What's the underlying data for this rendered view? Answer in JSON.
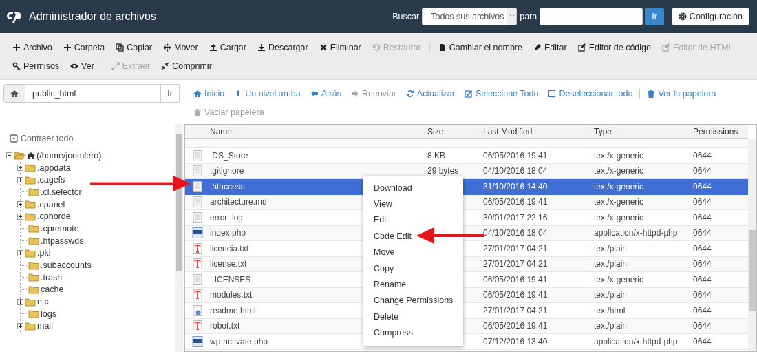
{
  "header": {
    "title": "Administrador de archivos",
    "search_label": "Buscar",
    "search_scope": "Todos sus archivos",
    "for_label": "para",
    "go_button": "Ir",
    "settings_button": "Configuración"
  },
  "toolbar": {
    "rows": [
      {
        "groups": [
          {
            "items": [
              {
                "label": "Archivo",
                "disabled": false
              },
              {
                "label": "Carpeta",
                "disabled": false
              },
              {
                "label": "Copiar",
                "disabled": false
              },
              {
                "label": "Mover",
                "disabled": false
              },
              {
                "label": "Cargar",
                "disabled": false
              },
              {
                "label": "Descargar",
                "disabled": false
              },
              {
                "label": "Eliminar",
                "disabled": false
              },
              {
                "label": "Restaurar",
                "disabled": true
              }
            ]
          },
          {
            "items": [
              {
                "label": "Cambiar el nombre",
                "disabled": false
              },
              {
                "label": "Editar",
                "disabled": false
              },
              {
                "label": "Editor de código",
                "disabled": false
              },
              {
                "label": "Editor de HTML",
                "disabled": true
              }
            ]
          }
        ]
      },
      {
        "groups": [
          {
            "items": [
              {
                "label": "Permisos",
                "disabled": false
              },
              {
                "label": "Ver",
                "disabled": false
              }
            ]
          },
          {
            "items": [
              {
                "label": "Extraer",
                "disabled": true
              },
              {
                "label": "Comprimir",
                "disabled": false
              }
            ]
          }
        ]
      }
    ]
  },
  "path_bar": {
    "value": "public_html",
    "go_button": "Ir"
  },
  "nav": {
    "rows": [
      {
        "groups": [
          {
            "items": [
              {
                "label": "Inicio",
                "disabled": false
              },
              {
                "label": "Un nivel arriba",
                "disabled": false
              },
              {
                "label": "Atrás",
                "disabled": false
              },
              {
                "label": "Reenviar",
                "disabled": true
              },
              {
                "label": "Actualizar",
                "disabled": false
              },
              {
                "label": "Seleccione Todo",
                "disabled": false
              },
              {
                "label": "Deseleccionar todo",
                "disabled": false
              }
            ]
          },
          {
            "items": [
              {
                "label": "Ver la papelera",
                "disabled": false
              }
            ]
          }
        ]
      },
      {
        "groups": [
          {
            "items": [
              {
                "label": "Vaciar papelera",
                "disabled": true
              }
            ]
          }
        ]
      }
    ]
  },
  "tree": {
    "collapse_all": "Contraer todo",
    "root": {
      "label": "(/home/joomlero)",
      "expanded": true,
      "children": [
        {
          "label": ".appdata",
          "expandable": true
        },
        {
          "label": ".cagefs",
          "expandable": true
        },
        {
          "label": ".cl.selector",
          "expandable": false
        },
        {
          "label": ".cpanel",
          "expandable": true
        },
        {
          "label": ".cphorde",
          "expandable": true
        },
        {
          "label": ".cpremote",
          "expandable": false
        },
        {
          "label": ".htpasswds",
          "expandable": false
        },
        {
          "label": ".pki",
          "expandable": true
        },
        {
          "label": ".subaccounts",
          "expandable": false
        },
        {
          "label": ".trash",
          "expandable": false
        },
        {
          "label": "cache",
          "expandable": false
        },
        {
          "label": "etc",
          "expandable": true
        },
        {
          "label": "logs",
          "expandable": false
        },
        {
          "label": "mail",
          "expandable": true
        }
      ]
    }
  },
  "table": {
    "columns": [
      "Name",
      "Size",
      "Last Modified",
      "Type",
      "Permissions"
    ],
    "rows": [
      {
        "kind": "generic",
        "name": ".DS_Store",
        "size": "8 KB",
        "modified": "06/05/2016 19:41",
        "type": "text/x-generic",
        "permissions": "0644",
        "selected": false
      },
      {
        "kind": "generic",
        "name": ".gitignore",
        "size": "29 bytes",
        "modified": "04/10/2016 18:04",
        "type": "text/x-generic",
        "permissions": "0644",
        "selected": false
      },
      {
        "kind": "generic",
        "name": ".htaccess",
        "modified": "31/10/2016 14:40",
        "type": "text/x-generic",
        "permissions": "0644",
        "selected": true
      },
      {
        "kind": "generic",
        "name": "architecture.md",
        "modified": "06/05/2016 19:41",
        "type": "text/x-generic",
        "permissions": "0644",
        "selected": false
      },
      {
        "kind": "generic",
        "name": "error_log",
        "modified": "30/01/2017 22:16",
        "type": "text/x-generic",
        "permissions": "0644",
        "selected": false
      },
      {
        "kind": "php",
        "name": "index.php",
        "modified": "04/10/2016 18:04",
        "type": "application/x-httpd-php",
        "permissions": "0644",
        "selected": false
      },
      {
        "kind": "text",
        "name": "licencia.txt",
        "modified": "27/01/2017 04:21",
        "type": "text/plain",
        "permissions": "0644",
        "selected": false
      },
      {
        "kind": "text",
        "name": "license.txt",
        "modified": "27/01/2017 04:21",
        "type": "text/plain",
        "permissions": "0644",
        "selected": false
      },
      {
        "kind": "generic",
        "name": "LICENSES",
        "modified": "06/05/2016 19:41",
        "type": "text/x-generic",
        "permissions": "0644",
        "selected": false
      },
      {
        "kind": "text",
        "name": "modules.txt",
        "modified": "06/05/2016 19:41",
        "type": "text/plain",
        "permissions": "0644",
        "selected": false
      },
      {
        "kind": "html",
        "name": "readme.html",
        "modified": "27/01/2017 04:21",
        "type": "text/html",
        "permissions": "0644",
        "selected": false
      },
      {
        "kind": "text",
        "name": "robot.txt",
        "modified": "06/05/2016 19:41",
        "type": "text/plain",
        "permissions": "0644",
        "selected": false
      },
      {
        "kind": "php",
        "name": "wp-activate.php",
        "modified": "07/12/2016 13:40",
        "type": "application/x-httpd-php",
        "permissions": "0644",
        "selected": false
      }
    ]
  },
  "context_menu": [
    "Download",
    "View",
    "Edit",
    "Code Edit",
    "Move",
    "Copy",
    "Rename",
    "Change Permissions",
    "Delete",
    "Compress"
  ]
}
